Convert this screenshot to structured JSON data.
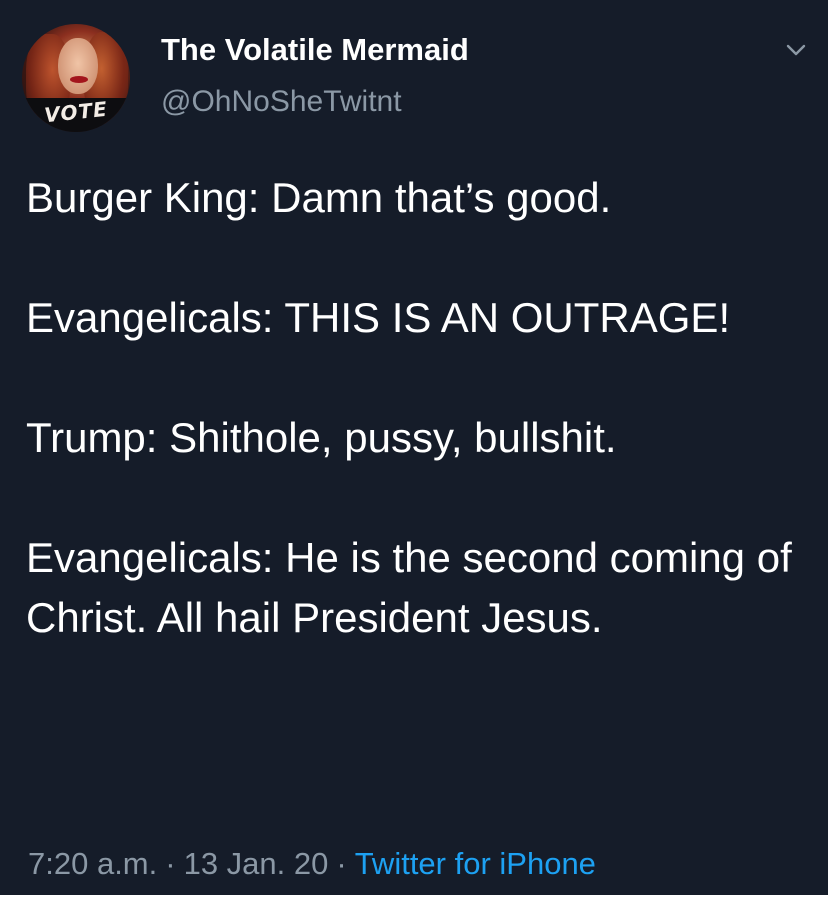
{
  "tweet": {
    "author": {
      "display_name": "The Volatile Mermaid",
      "handle": "@OhNoSheTwitnt",
      "avatar_icon": "profile-photo",
      "avatar_text": "VOTE"
    },
    "menu_icon": "chevron-down-icon",
    "paragraphs": [
      "Burger King: Damn that’s good.",
      "Evangelicals: THIS IS AN OUTRAGE!",
      "Trump: Shithole, pussy, bullshit.",
      "Evangelicals: He is the second coming of Christ. All hail President Jesus."
    ],
    "time": "7:20 a.m.",
    "date": "13 Jan. 20",
    "separator": "·",
    "source": "Twitter for iPhone"
  },
  "colors": {
    "background": "#151c29",
    "text": "#ffffff",
    "secondary_text": "#8b98a5",
    "link": "#1da1f2"
  }
}
